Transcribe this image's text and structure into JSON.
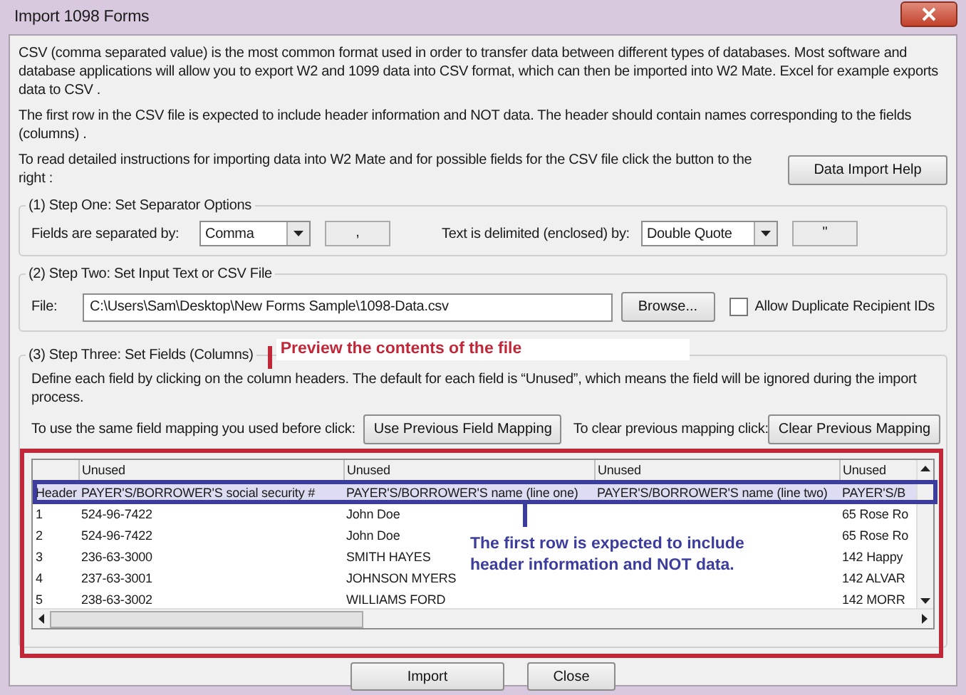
{
  "window": {
    "title": "Import 1098 Forms"
  },
  "intro": [
    "CSV (comma separated value) is the most common format used in order to transfer data between different types of databases.  Most software and database applications will allow you to export W2 and 1099 data into CSV format, which can then be imported into W2 Mate. Excel for example exports data to CSV .",
    "The first row in the CSV file is expected to include header information and NOT data. The header should contain names corresponding to the fields (columns) ."
  ],
  "help": {
    "prompt": "To read detailed instructions for importing data into W2 Mate and for possible fields for the CSV file click the button to the right :",
    "button": "Data Import Help"
  },
  "step1": {
    "legend": "(1)  Step One: Set Separator Options",
    "fields_label": "Fields are separated by:",
    "field_separator": "Comma",
    "separator_char": ",",
    "text_label": "Text is delimited (enclosed) by:",
    "text_delimiter": "Double Quote",
    "delimiter_char": "\""
  },
  "step2": {
    "legend": "(2)  Step Two: Set Input Text or CSV File",
    "file_label": "File:",
    "file_path": "C:\\Users\\Sam\\Desktop\\New Forms Sample\\1098-Data.csv",
    "browse_button": "Browse...",
    "allow_duplicates": {
      "label": "Allow Duplicate Recipient IDs",
      "checked": false
    }
  },
  "step3": {
    "legend": "(3)  Step Three: Set Fields (Columns)",
    "description": "Define each field by clicking on the column headers. The default for each field is “Unused”, which means the field will be ignored during the import process.",
    "use_previous_prompt": "To use the same field mapping you used before click:",
    "use_previous_button": "Use Previous Field Mapping",
    "clear_prompt": "To clear previous mapping click:",
    "clear_button": "Clear Previous Mapping",
    "grid": {
      "columns": [
        "Unused",
        "Unused",
        "Unused",
        "Unused"
      ],
      "rows": [
        {
          "kind": "header",
          "label": "Header",
          "cells": [
            "PAYER'S/BORROWER'S social security #",
            "PAYER'S/BORROWER'S name (line one)",
            "PAYER'S/BORROWER'S name (line two)",
            "PAYER'S/B"
          ]
        },
        {
          "kind": "data",
          "label": "1",
          "cells": [
            "524-96-7422",
            "John Doe",
            "",
            "65 Rose Ro"
          ]
        },
        {
          "kind": "data",
          "label": "2",
          "cells": [
            "524-96-7422",
            "John Doe",
            "",
            "65 Rose Ro"
          ]
        },
        {
          "kind": "data",
          "label": "3",
          "cells": [
            "236-63-3000",
            "SMITH HAYES",
            "",
            "142 Happy"
          ]
        },
        {
          "kind": "data",
          "label": "4",
          "cells": [
            "237-63-3001",
            "JOHNSON MYERS",
            "",
            "142 ALVAR"
          ]
        },
        {
          "kind": "data",
          "label": "5",
          "cells": [
            "238-63-3002",
            "WILLIAMS FORD",
            "",
            "142 MORR"
          ]
        }
      ]
    }
  },
  "annotations": [
    {
      "text": "Preview the contents of the file",
      "color": "#c0283a"
    },
    {
      "text": "The first row is expected to include header information and NOT data.",
      "color": "#3c3c9c"
    }
  ],
  "buttons": [
    "Import",
    "Close"
  ]
}
